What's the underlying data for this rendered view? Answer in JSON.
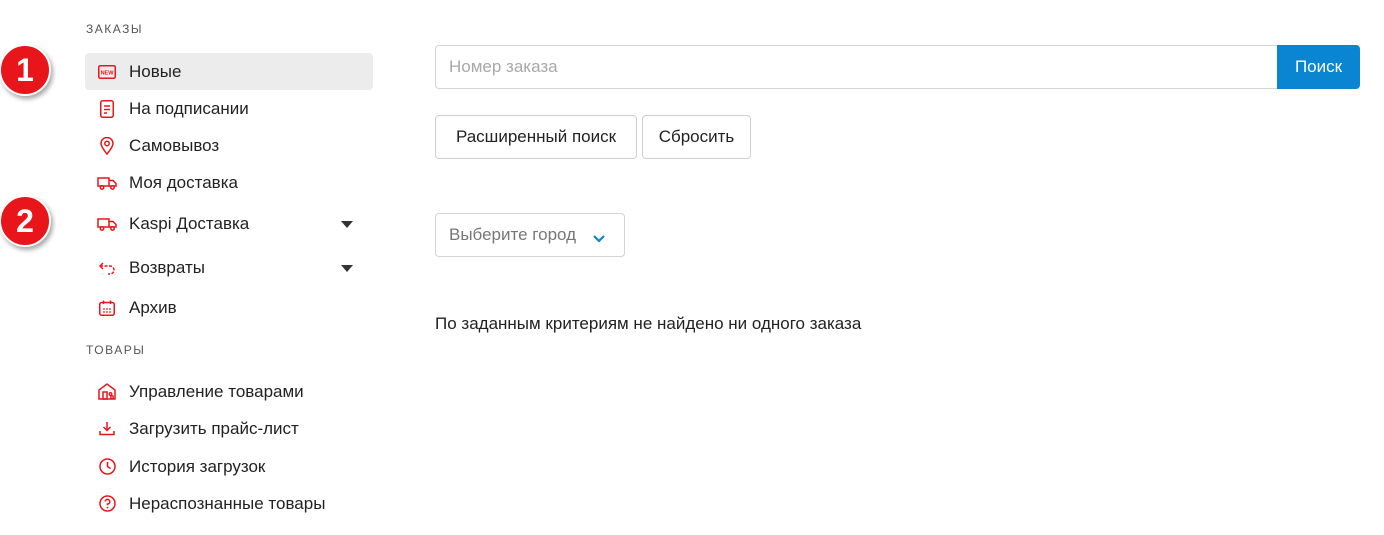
{
  "sidebar": {
    "orders_title": "ЗАКАЗЫ",
    "orders_items": [
      {
        "label": "Новые",
        "icon": "new-icon"
      },
      {
        "label": "На подписании",
        "icon": "document-icon"
      },
      {
        "label": "Самовывоз",
        "icon": "location-pin-icon"
      },
      {
        "label": "Моя доставка",
        "icon": "truck-icon"
      },
      {
        "label": "Kaspi Доставка",
        "icon": "truck-icon"
      },
      {
        "label": "Возвраты",
        "icon": "return-icon"
      },
      {
        "label": "Архив",
        "icon": "calendar-icon"
      }
    ],
    "products_title": "ТОВАРЫ",
    "products_items": [
      {
        "label": "Управление товарами",
        "icon": "store-icon"
      },
      {
        "label": "Загрузить прайс-лист",
        "icon": "download-icon"
      },
      {
        "label": "История загрузок",
        "icon": "clock-icon"
      },
      {
        "label": "Нераспознанные товары",
        "icon": "question-icon"
      }
    ]
  },
  "badges": [
    "1",
    "2"
  ],
  "search": {
    "placeholder": "Номер заказа",
    "value": "",
    "button_label": "Поиск"
  },
  "actions": {
    "advanced_label": "Расширенный поиск",
    "reset_label": "Сбросить"
  },
  "city_select": {
    "placeholder": "Выберите город"
  },
  "empty_message": "По заданным критериям не найдено ни одного заказа",
  "colors": {
    "accent_red": "#e8161b",
    "primary_blue": "#0a85d1",
    "active_bg": "#ececec"
  }
}
